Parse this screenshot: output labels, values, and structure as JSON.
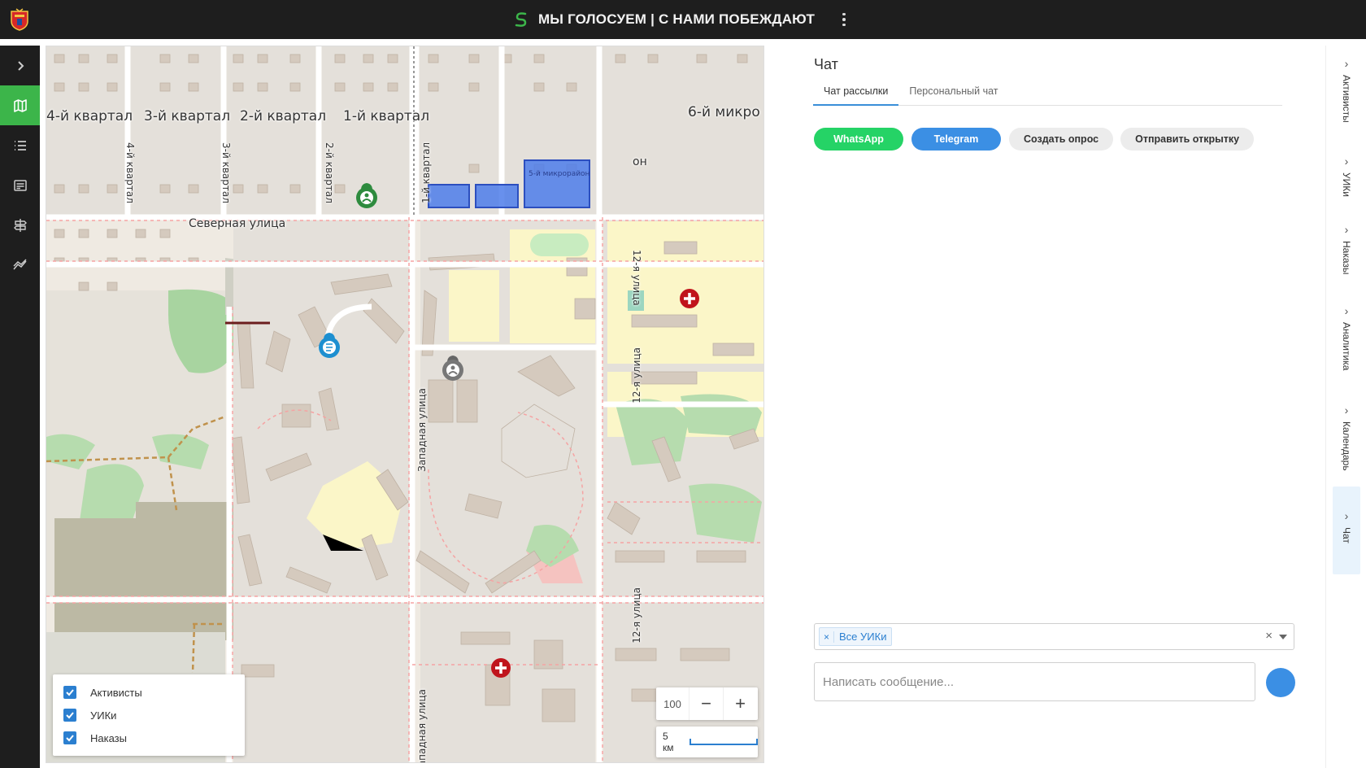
{
  "header": {
    "title": "МЫ ГОЛОСУЕМ | С НАМИ ПОБЕЖДАЮТ"
  },
  "sidebar": {
    "items": [
      {
        "icon": "chevron-right-icon"
      },
      {
        "icon": "map-icon",
        "active": true
      },
      {
        "icon": "list-icon"
      },
      {
        "icon": "news-icon"
      },
      {
        "icon": "signpost-icon"
      },
      {
        "icon": "trend-icon"
      }
    ]
  },
  "map": {
    "labels": {
      "kv4": "4-й квартал",
      "kv3": "3-й квартал",
      "kv2": "2-й квартал",
      "kv1": "1-й квартал",
      "micro6": "6-й микро",
      "micro5": "5-й микрорайон",
      "on": "он",
      "severnaya": "Северная улица",
      "kv4v": "4-й квартал",
      "kv3v": "3-й квартал",
      "kv2v": "2-й квартал",
      "kv1v": "1-й квартал",
      "zapadnaya": "Западная улица",
      "zapadnaya2": "Западная улица",
      "ul12a": "12-я улица",
      "ul12b": "12-я улица",
      "ul12c": "12-я улица"
    },
    "layers": [
      {
        "label": "Активисты",
        "checked": true
      },
      {
        "label": "УИКи",
        "checked": true
      },
      {
        "label": "Наказы",
        "checked": true
      }
    ],
    "zoom": "100",
    "zoom_minus": "−",
    "zoom_plus": "+",
    "scale": "5 км"
  },
  "chat": {
    "title": "Чат",
    "tabs": [
      {
        "label": "Чат рассылки",
        "active": true
      },
      {
        "label": "Персональный чат",
        "active": false
      }
    ],
    "buttons": {
      "whatsapp": "WhatsApp",
      "telegram": "Telegram",
      "poll": "Создать опрос",
      "postcard": "Отправить открытку"
    },
    "uik_tag": "Все УИКи",
    "tag_remove": "×",
    "clear": "×",
    "message_placeholder": "Написать сообщение..."
  },
  "right_tabs": [
    {
      "label": "Активисты"
    },
    {
      "label": "УИКи"
    },
    {
      "label": "Наказы"
    },
    {
      "label": "Аналитика"
    },
    {
      "label": "Календарь"
    },
    {
      "label": "Чат",
      "active": true
    }
  ],
  "colors": {
    "accent_green": "#3cb54a",
    "whatsapp": "#25d366",
    "telegram": "#3b8fe4",
    "topbar": "#1e1e1e",
    "checkbox": "#2b7fd0"
  }
}
